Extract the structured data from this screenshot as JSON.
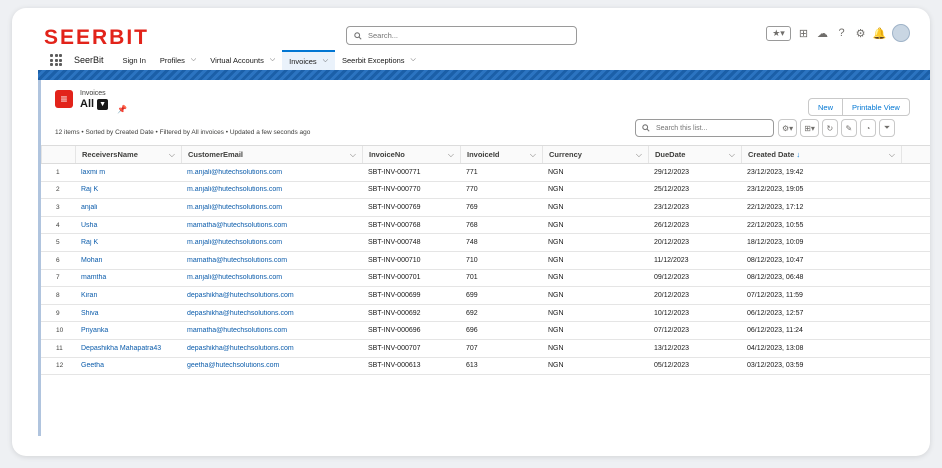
{
  "brand": {
    "logo_text": "SEERBIT",
    "accent": "#e2231a"
  },
  "header": {
    "search_placeholder": "Search..."
  },
  "nav": {
    "app_name": "SeerBit",
    "items": [
      {
        "label": "Sign In",
        "dropdown": false
      },
      {
        "label": "Profiles",
        "dropdown": true
      },
      {
        "label": "Virtual Accounts",
        "dropdown": true
      },
      {
        "label": "Invoices",
        "dropdown": true,
        "active": true
      },
      {
        "label": "Seerbit Exceptions",
        "dropdown": true
      }
    ]
  },
  "list": {
    "object_label": "Invoices",
    "view_name": "All",
    "meta": "12 items • Sorted by Created Date • Filtered by All invoices • Updated a few seconds ago",
    "new_label": "New",
    "printable_label": "Printable View",
    "search_placeholder": "Search this list..."
  },
  "columns": [
    "ReceiversName",
    "CustomerEmail",
    "InvoiceNo",
    "InvoiceId",
    "Currency",
    "DueDate",
    "Created Date"
  ],
  "rows": [
    {
      "n": "1",
      "name": "laxmi m",
      "email": "m.anjali@hutechsolutions.com",
      "no": "SBT-INV-000771",
      "id": "771",
      "cur": "NGN",
      "due": "29/12/2023",
      "created": "23/12/2023, 19:42"
    },
    {
      "n": "2",
      "name": "Raj K",
      "email": "m.anjali@hutechsolutions.com",
      "no": "SBT-INV-000770",
      "id": "770",
      "cur": "NGN",
      "due": "25/12/2023",
      "created": "23/12/2023, 19:05"
    },
    {
      "n": "3",
      "name": "anjali",
      "email": "m.anjali@hutechsolutions.com",
      "no": "SBT-INV-000769",
      "id": "769",
      "cur": "NGN",
      "due": "23/12/2023",
      "created": "22/12/2023, 17:12"
    },
    {
      "n": "4",
      "name": "Usha",
      "email": "mamatha@hutechsolutions.com",
      "no": "SBT-INV-000768",
      "id": "768",
      "cur": "NGN",
      "due": "26/12/2023",
      "created": "22/12/2023, 10:55"
    },
    {
      "n": "5",
      "name": "Raj K",
      "email": "m.anjali@hutechsolutions.com",
      "no": "SBT-INV-000748",
      "id": "748",
      "cur": "NGN",
      "due": "20/12/2023",
      "created": "18/12/2023, 10:09"
    },
    {
      "n": "6",
      "name": "Mohan",
      "email": "mamatha@hutechsolutions.com",
      "no": "SBT-INV-000710",
      "id": "710",
      "cur": "NGN",
      "due": "11/12/2023",
      "created": "08/12/2023, 10:47"
    },
    {
      "n": "7",
      "name": "mamtha",
      "email": "m.anjali@hutechsolutions.com",
      "no": "SBT-INV-000701",
      "id": "701",
      "cur": "NGN",
      "due": "09/12/2023",
      "created": "08/12/2023, 06:48"
    },
    {
      "n": "8",
      "name": "Kiran",
      "email": "depashikha@hutechsolutions.com",
      "no": "SBT-INV-000699",
      "id": "699",
      "cur": "NGN",
      "due": "20/12/2023",
      "created": "07/12/2023, 11:59"
    },
    {
      "n": "9",
      "name": "Shiva",
      "email": "depashikha@hutechsolutions.com",
      "no": "SBT-INV-000692",
      "id": "692",
      "cur": "NGN",
      "due": "10/12/2023",
      "created": "06/12/2023, 12:57"
    },
    {
      "n": "10",
      "name": "Priyanka",
      "email": "mamatha@hutechsolutions.com",
      "no": "SBT-INV-000696",
      "id": "696",
      "cur": "NGN",
      "due": "07/12/2023",
      "created": "06/12/2023, 11:24"
    },
    {
      "n": "11",
      "name": "Depashikha Mahapatra43",
      "email": "depashikha@hutechsolutions.com",
      "no": "SBT-INV-000707",
      "id": "707",
      "cur": "NGN",
      "due": "13/12/2023",
      "created": "04/12/2023, 13:08"
    },
    {
      "n": "12",
      "name": "Geetha",
      "email": "geetha@hutechsolutions.com",
      "no": "SBT-INV-000613",
      "id": "613",
      "cur": "NGN",
      "due": "05/12/2023",
      "created": "03/12/2023, 03:59"
    }
  ]
}
